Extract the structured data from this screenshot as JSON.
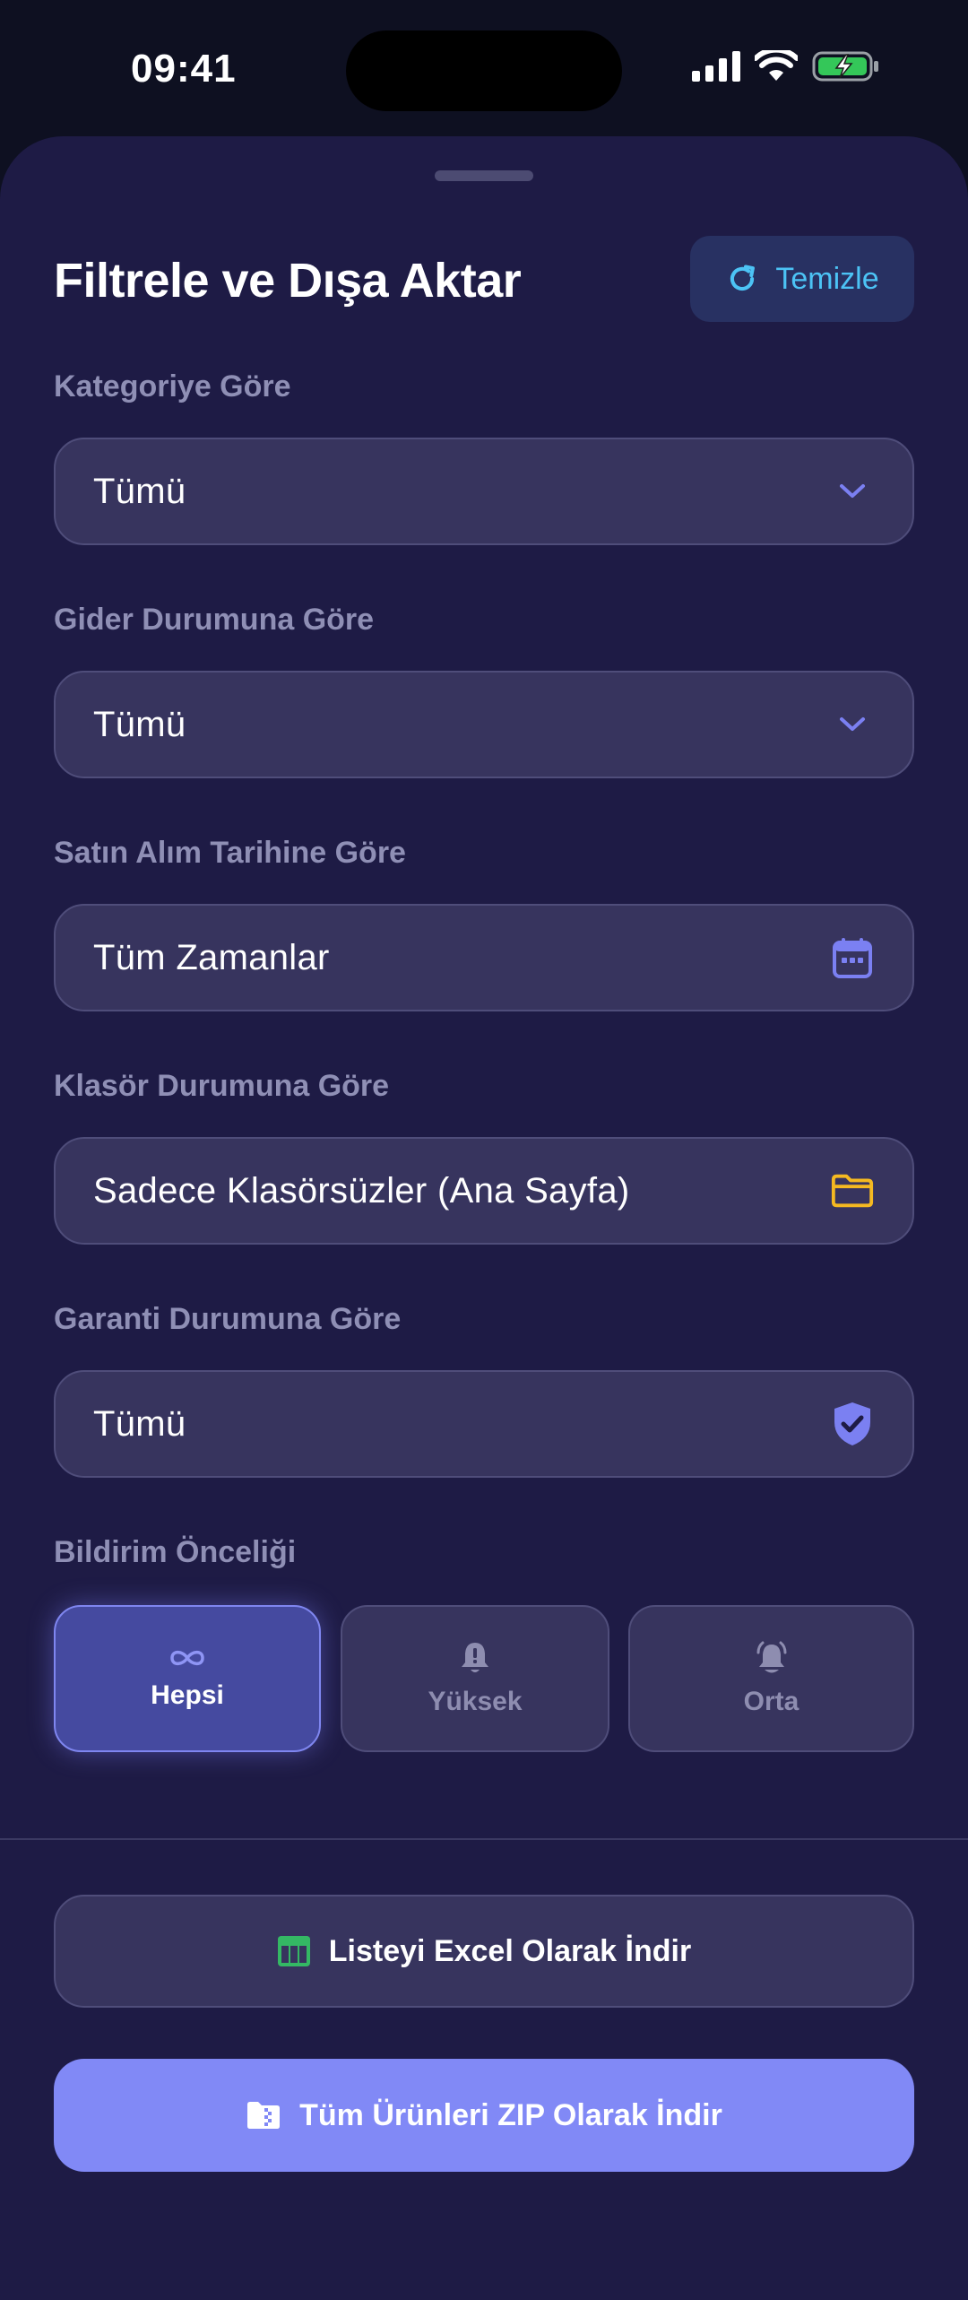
{
  "status": {
    "time": "09:41"
  },
  "sheet": {
    "title": "Filtrele ve Dışa Aktar",
    "clear_label": "Temizle"
  },
  "filters": [
    {
      "label": "Kategoriye Göre",
      "value": "Tümü",
      "icon": "chevron-down-icon"
    },
    {
      "label": "Gider Durumuna Göre",
      "value": "Tümü",
      "icon": "chevron-down-icon"
    },
    {
      "label": "Satın Alım Tarihine Göre",
      "value": "Tüm Zamanlar",
      "icon": "calendar-icon"
    },
    {
      "label": "Klasör Durumuna Göre",
      "value": "Sadece Klasörsüzler (Ana Sayfa)",
      "icon": "folder-icon"
    },
    {
      "label": "Garanti Durumuna Göre",
      "value": "Tümü",
      "icon": "shield-check-icon"
    }
  ],
  "priority": {
    "label": "Bildirim Önceliği",
    "options": [
      {
        "label": "Hepsi",
        "icon": "infinity-icon",
        "selected": true
      },
      {
        "label": "Yüksek",
        "icon": "bell-alert-icon",
        "selected": false
      },
      {
        "label": "Orta",
        "icon": "bell-ring-icon",
        "selected": false
      }
    ]
  },
  "actions": {
    "excel_label": "Listeyi Excel Olarak İndir",
    "zip_label": "Tüm Ürünleri ZIP Olarak İndir"
  },
  "colors": {
    "sheet_bg": "#1e1b45",
    "accent": "#8189f6",
    "clear_text": "#4cc3f5",
    "chevron": "#7b80f2",
    "folder": "#f5b921",
    "excel_green": "#34b864"
  }
}
